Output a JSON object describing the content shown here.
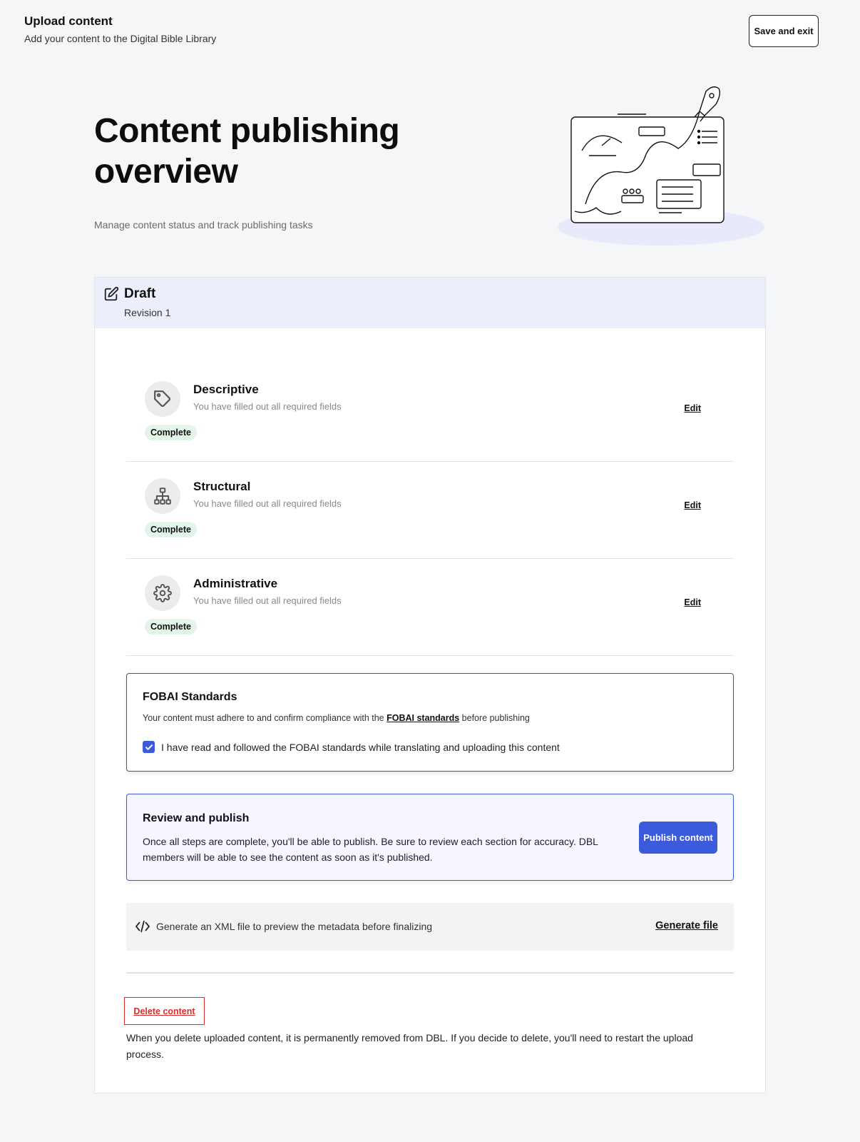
{
  "header": {
    "title": "Upload content",
    "subtitle": "Add your content to the Digital Bible Library",
    "save_exit_label": "Save and exit"
  },
  "hero": {
    "title": "Content publishing overview",
    "description": "Manage content status and track publishing tasks"
  },
  "status_card": {
    "status": "Draft",
    "revision": "Revision 1",
    "sections": [
      {
        "title": "Descriptive",
        "description": "You have filled out all required fields",
        "badge": "Complete",
        "edit_label": "Edit",
        "icon": "tag-icon"
      },
      {
        "title": "Structural",
        "description": "You have filled out all required fields",
        "badge": "Complete",
        "edit_label": "Edit",
        "icon": "hierarchy-icon"
      },
      {
        "title": "Administrative",
        "description": "You have filled out all required fields",
        "badge": "Complete",
        "edit_label": "Edit",
        "icon": "gear-icon"
      }
    ],
    "fobai": {
      "title": "FOBAI Standards",
      "text_before": "Your content must adhere to and confirm compliance with the ",
      "link": "FOBAI standards",
      "text_after": " before publishing",
      "checkbox_label": "I have read and followed the FOBAI standards while translating and uploading this content",
      "checked": true
    },
    "review": {
      "title": "Review and publish",
      "text": "Once all steps are complete, you'll be able to publish. Be sure to review each section for accuracy. DBL members will be able to see the content as soon as it's published.",
      "button_label": "Publish content"
    },
    "xml": {
      "text": "Generate an XML file to preview the metadata before finalizing",
      "link": "Generate file"
    },
    "delete": {
      "button_label": "Delete content",
      "text": "When you delete uploaded content, it is permanently removed from DBL. If you decide to delete, you'll need to restart the upload process."
    }
  },
  "colors": {
    "accent": "#3b5bdb",
    "danger": "#d92b2b",
    "success_badge": "#e3f5e6",
    "header_tint": "#eceefb"
  }
}
